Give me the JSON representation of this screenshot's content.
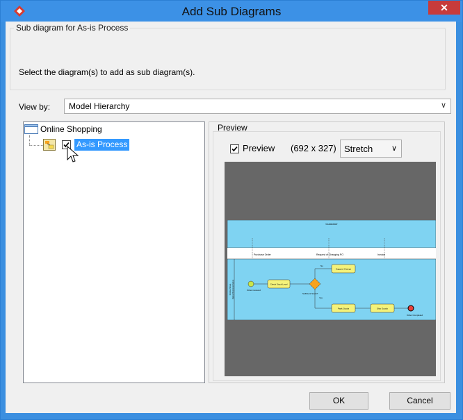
{
  "window": {
    "title": "Add Sub Diagrams",
    "close_label": "✕"
  },
  "group": {
    "legend": "Sub diagram for As-is Process",
    "text": "Select the diagram(s) to add as sub diagram(s)."
  },
  "view_by": {
    "label": "View by:",
    "value": "Model Hierarchy"
  },
  "tree": {
    "root": "Online Shopping",
    "child": "As-is Process",
    "child_checked": true
  },
  "preview": {
    "legend": "Preview",
    "checkbox_label": "Preview",
    "checked": true,
    "size": "(692 x 327)",
    "mode": "Stretch"
  },
  "diagram": {
    "pool_label": "Customer",
    "lane_labels": [
      "Online Shop",
      "Sales Representative"
    ],
    "messages": [
      "Purchase Order",
      "Request of Changing PO",
      "Invoice"
    ],
    "tasks": [
      "Check Stock Level",
      "Suggest Change",
      "Pack Goods",
      "Ship Goods"
    ],
    "gateway_label": "Sufficient Stock?",
    "gateway_yes": "Yes",
    "gateway_no": "No",
    "start_label": "Order received",
    "end_label": "Order Completed"
  },
  "buttons": {
    "ok": "OK",
    "cancel": "Cancel"
  },
  "colors": {
    "title_bar": "#3c91e6",
    "selection": "#3399ff",
    "pool_fill": "#7fd3f2",
    "task_fill": "#f4f27a",
    "gateway_fill": "#f7a21c"
  }
}
